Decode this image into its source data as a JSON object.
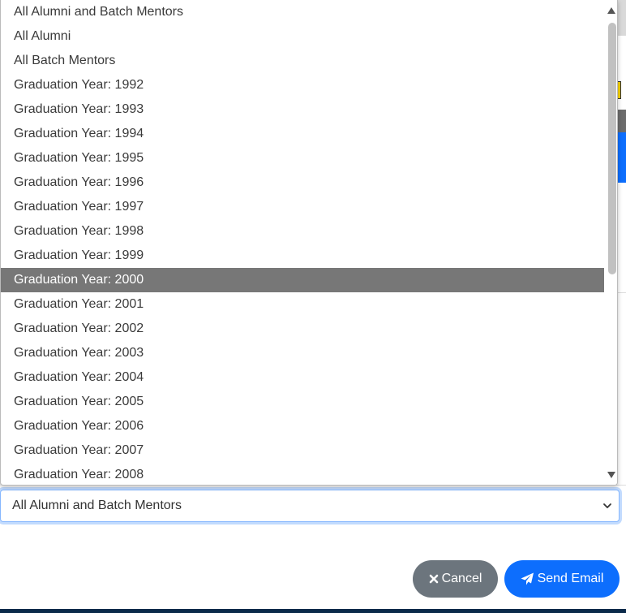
{
  "dropdown": {
    "options": [
      "All Alumni and Batch Mentors",
      "All Alumni",
      "All Batch Mentors",
      "Graduation Year: 1992",
      "Graduation Year: 1993",
      "Graduation Year: 1994",
      "Graduation Year: 1995",
      "Graduation Year: 1996",
      "Graduation Year: 1997",
      "Graduation Year: 1998",
      "Graduation Year: 1999",
      "Graduation Year: 2000",
      "Graduation Year: 2001",
      "Graduation Year: 2002",
      "Graduation Year: 2003",
      "Graduation Year: 2004",
      "Graduation Year: 2005",
      "Graduation Year: 2006",
      "Graduation Year: 2007",
      "Graduation Year: 2008"
    ],
    "highlighted": "Graduation Year: 2000"
  },
  "select": {
    "value": "All Alumni and Batch Mentors"
  },
  "buttons": {
    "cancel_label": "Cancel",
    "send_label": "Send Email"
  },
  "icons": {
    "cancel": "times-icon",
    "send": "paper-plane-icon",
    "select": "chevron-down-icon"
  },
  "colors": {
    "highlight": "#777777",
    "cancel": "#6c757d",
    "send": "#0d6efd"
  }
}
